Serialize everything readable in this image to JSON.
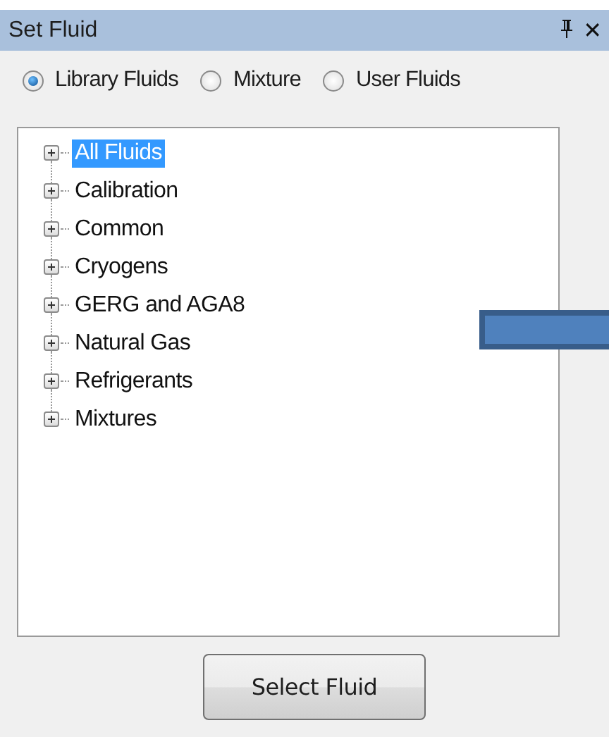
{
  "window": {
    "title": "Set Fluid",
    "close": "✕"
  },
  "sources": [
    {
      "label": "Library Fluids",
      "selected": true
    },
    {
      "label": "Mixture",
      "selected": false
    },
    {
      "label": "User Fluids",
      "selected": false
    }
  ],
  "tree": {
    "items": [
      {
        "label": "All Fluids",
        "selected": true,
        "expanded": false
      },
      {
        "label": "Calibration",
        "selected": false,
        "expanded": false
      },
      {
        "label": "Common",
        "selected": false,
        "expanded": false
      },
      {
        "label": "Cryogens",
        "selected": false,
        "expanded": false
      },
      {
        "label": "GERG and AGA8",
        "selected": false,
        "expanded": false
      },
      {
        "label": "Natural Gas",
        "selected": false,
        "expanded": false
      },
      {
        "label": "Refrigerants",
        "selected": false,
        "expanded": false
      },
      {
        "label": "Mixtures",
        "selected": false,
        "expanded": false
      }
    ]
  },
  "buttons": [
    "Select Fluid"
  ]
}
